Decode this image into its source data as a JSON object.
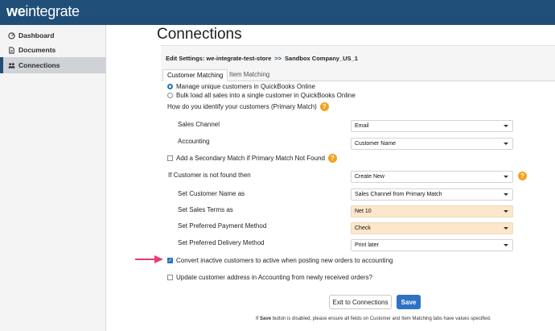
{
  "header": {
    "logo_prefix": "we",
    "logo_suffix": "integrate"
  },
  "sidebar": {
    "items": [
      {
        "label": "Dashboard",
        "icon": "dashboard-icon"
      },
      {
        "label": "Documents",
        "icon": "document-icon"
      },
      {
        "label": "Connections",
        "icon": "connections-icon",
        "active": true
      }
    ]
  },
  "page": {
    "title": "Connections"
  },
  "edit_settings": {
    "prefix": "Edit Settings: we-integrate-test-store",
    "separator": ">>",
    "target": "Sandbox Company_US_1"
  },
  "tabs": [
    {
      "label": "Customer Matching",
      "active": true
    },
    {
      "label": "Item Matching",
      "active": false
    }
  ],
  "customer_mode": {
    "options": [
      {
        "label": "Manage unique customers in QuickBooks Online",
        "selected": true
      },
      {
        "label": "Bulk load all sales into a single customer in QuickBooks Online",
        "selected": false
      }
    ]
  },
  "primary_match": {
    "question": "How do you identify your customers (Primary Match)",
    "fields": [
      {
        "label": "Sales Channel",
        "value": "Email"
      },
      {
        "label": "Accounting",
        "value": "Customer Name"
      }
    ]
  },
  "secondary_match": {
    "label": "Add a Secondary Match if Primary Match Not Found",
    "checked": false
  },
  "not_found": {
    "label": "If Customer is not found then",
    "value": "Create New",
    "fields": [
      {
        "label": "Set Customer Name as",
        "value": "Sales Channel from Primary Match",
        "highlight": false
      },
      {
        "label": "Set Sales Terms as",
        "value": "Net 10",
        "highlight": true
      },
      {
        "label": "Set Preferred Payment Method",
        "value": "Check",
        "highlight": true
      },
      {
        "label": "Set Preferred Delivery Method",
        "value": "Print later",
        "highlight": false
      }
    ]
  },
  "options": {
    "convert_inactive": {
      "label": "Convert inactive customers to active when posting new orders to accounting",
      "checked": true
    },
    "update_address": {
      "label": "Update customer address in Accounting from newly received orders?",
      "checked": false
    }
  },
  "help_glyph": "?",
  "check_glyph": "✓",
  "buttons": {
    "exit": "Exit to Connections",
    "save": "Save"
  },
  "footnote": {
    "pre": "If ",
    "bold": "Save",
    "post": " button is disabled, please ensure all fields on Customer and Item Matching tabs have values specified."
  },
  "colors": {
    "header_bg": "#1f4f78",
    "primary_button": "#2e72c4",
    "help_icon": "#f3a21b",
    "highlight_field": "#fce7cb",
    "annotation_arrow": "#e63b7a"
  }
}
